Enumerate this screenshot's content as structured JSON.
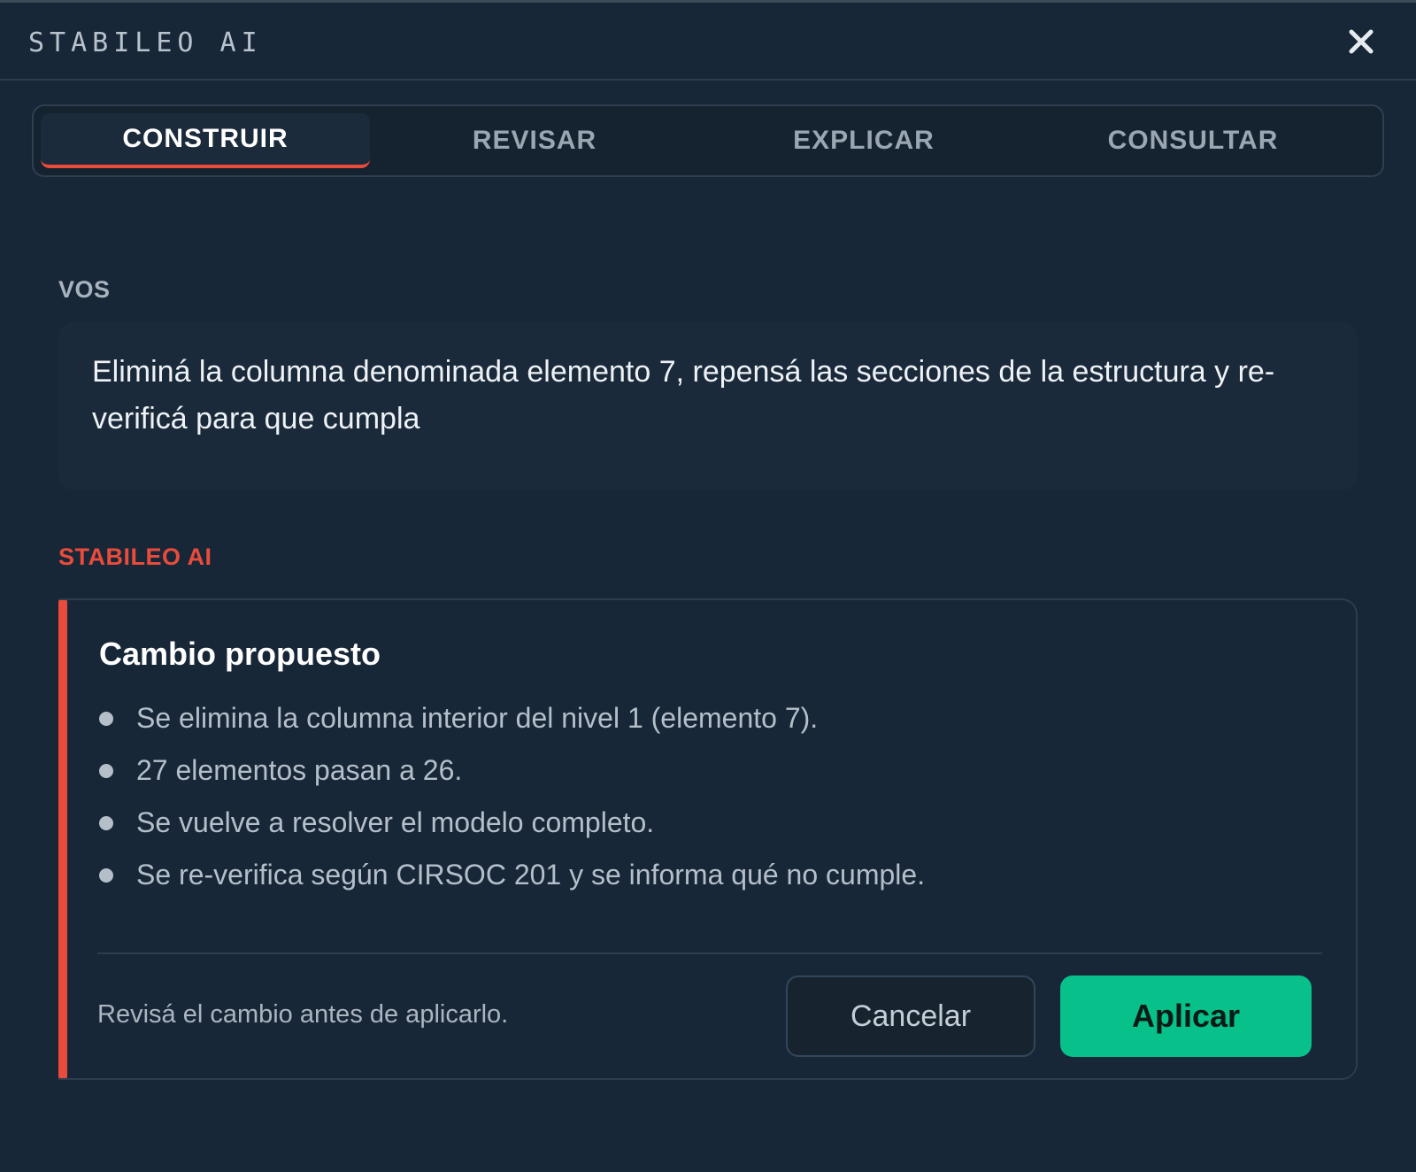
{
  "window": {
    "title": "STABILEO AI",
    "close_icon": "close-icon"
  },
  "tabs": [
    {
      "label": "CONSTRUIR",
      "active": true
    },
    {
      "label": "REVISAR",
      "active": false
    },
    {
      "label": "EXPLICAR",
      "active": false
    },
    {
      "label": "CONSULTAR",
      "active": false
    }
  ],
  "conversation": {
    "user_label": "VOS",
    "user_message": "Eliminá la columna denominada elemento 7, repensá las secciones de la estructura y re-verificá para que cumpla",
    "ai_label": "STABILEO AI",
    "proposal": {
      "title": "Cambio propuesto",
      "items": [
        "Se elimina la columna interior del nivel 1 (elemento 7).",
        "27 elementos pasan a 26.",
        "Se vuelve a resolver el modelo completo.",
        "Se re-verifica según CIRSOC 201 y se informa qué no cumple."
      ],
      "hint": "Revisá el cambio antes de aplicarlo.",
      "cancel_label": "Cancelar",
      "apply_label": "Aplicar"
    }
  },
  "colors": {
    "background": "#182738",
    "accent": "#e94c3a",
    "apply": "#08c08a"
  }
}
